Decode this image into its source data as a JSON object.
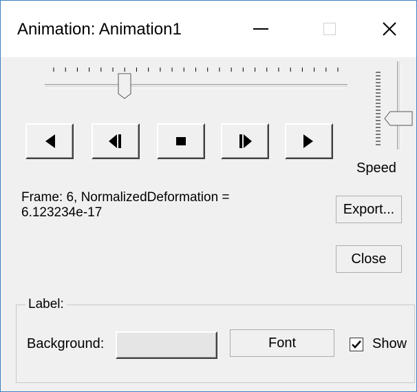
{
  "window": {
    "title": "Animation: Animation1",
    "minimize_icon": "minimize-icon",
    "maximize_icon": "maximize-icon",
    "close_icon": "close-icon"
  },
  "frame_slider": {
    "value": 6,
    "min": 0,
    "max": 24,
    "tick_count": 25
  },
  "speed_slider": {
    "label": "Speed",
    "position_fraction": 0.55
  },
  "transport": {
    "first_icon": "play-reverse-icon",
    "step_back_icon": "step-backward-icon",
    "stop_icon": "stop-icon",
    "step_forward_icon": "step-forward-icon",
    "play_icon": "play-icon"
  },
  "status": {
    "line1": "Frame: 6, NormalizedDeformation =",
    "line2": "6.123234e-17"
  },
  "buttons": {
    "export": "Export...",
    "close": "Close",
    "font": "Font"
  },
  "label_group": {
    "legend": "Label:",
    "background_label": "Background:",
    "background_color": "#e5e5e5",
    "show_label": "Show",
    "show_checked": true
  },
  "colors": {
    "window_border": "#3c7fc1",
    "dialog_bg": "#f0f0f0"
  }
}
